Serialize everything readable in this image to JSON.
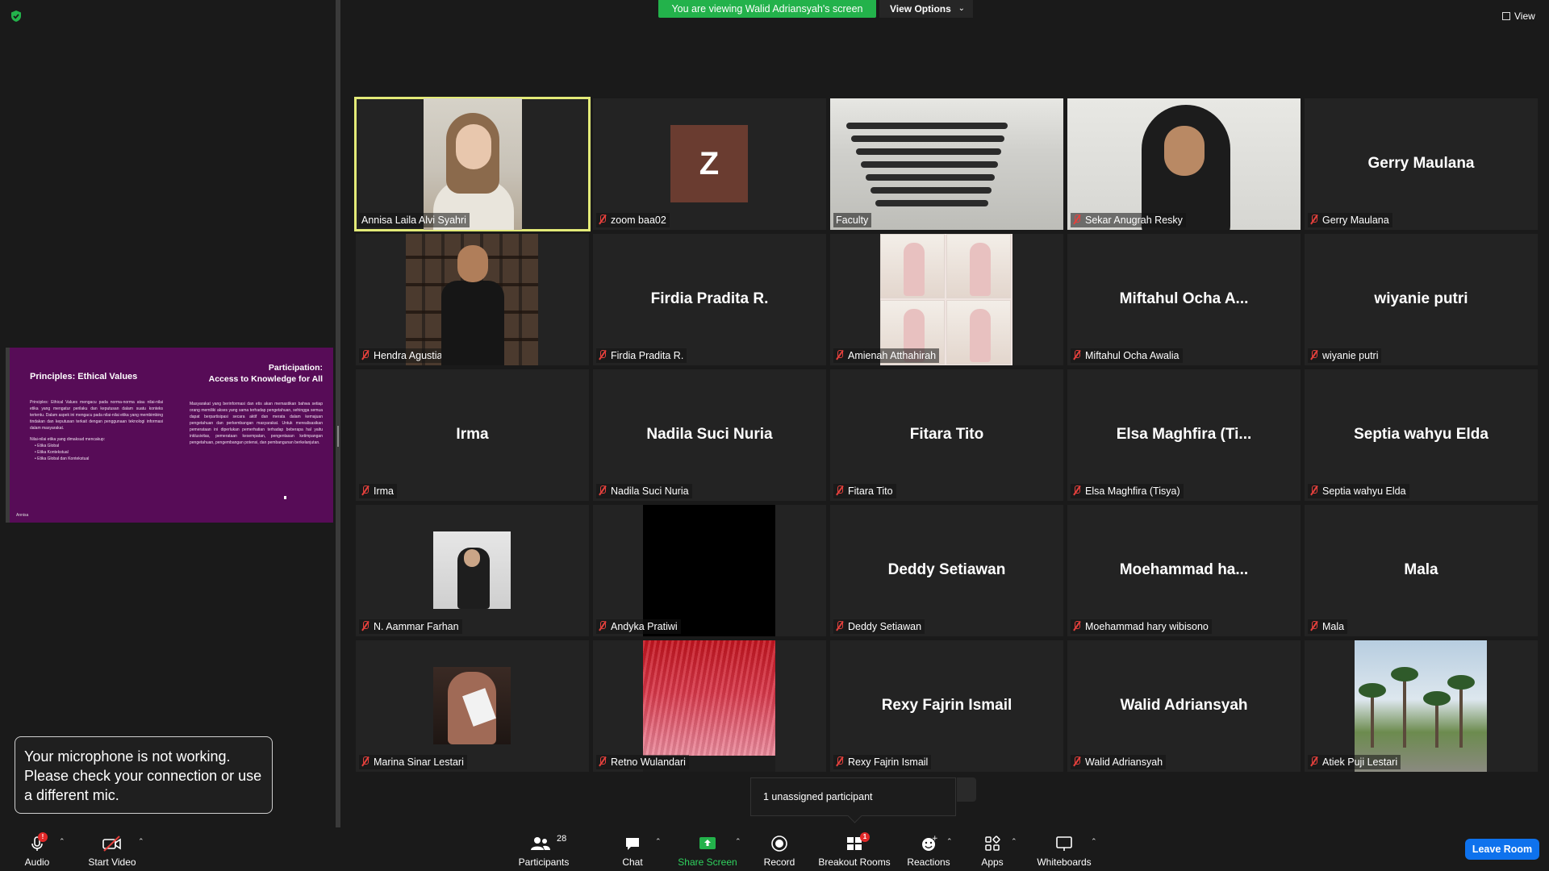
{
  "banner": {
    "viewing_text": "You are viewing Walid Adriansyah's screen",
    "view_options_label": "View Options",
    "view_label": "View"
  },
  "shared_screen": {
    "left_title": "Principles: Ethical Values",
    "left_body": "Principles: Ethical Values mengacu pada norma-norma atau nilai-nilai etika yang mengatur perilaku dan keputusan dalam suatu konteks tertentu. Dalam aspek ini mengacu pada nilai-nilai etika yang membimbing tindakan dan keputusan terkait dengan penggunaan teknologi informasi dalam masyarakat.",
    "left_sub": "Nilai-nilai etika yang dimaksud mencakup:",
    "left_list": [
      "Etika Global",
      "Etika Kontekstual",
      "Etika Global dan Kontekstual"
    ],
    "right_title_1": "Participation:",
    "right_title_2": "Access to Knowledge for All",
    "right_body": "Masyarakat yang berinformasi dan etis akan memastikan bahwa setiap orang memiliki akses yang sama terhadap pengetahuan, sehingga semua dapat berpartisipasi secara aktif dan merata dalam kemajuan pengetahuan dan perkembangan masyarakat. Untuk merealisasikan pemerataan ini diperlukan pemerhatian terhadap beberapa hal yaitu inklusivitas, pemerataan kesempatan, pengentasan ketimpangan pengetahuan, pengembangan potensi, dan pembangunan berkelanjutan.",
    "footer": "Annisa"
  },
  "mic_toast": {
    "message": "Your microphone is not working. Please check your connection or use a different mic."
  },
  "participants": [
    {
      "label": "Annisa Laila Alvi Syahri",
      "big": "",
      "video": "annisa",
      "muted": false,
      "active": true
    },
    {
      "label": "zoom baa02",
      "big": "",
      "video": "avatar-z",
      "avatar_letter": "Z",
      "muted": true
    },
    {
      "label": "Faculty",
      "big": "",
      "video": "class",
      "muted": false
    },
    {
      "label": "Sekar Anugrah Resky",
      "big": "",
      "video": "sekar",
      "muted": true
    },
    {
      "label": "Gerry Maulana",
      "big": "Gerry Maulana",
      "video": "none",
      "muted": true
    },
    {
      "label": "Hendra Agustian",
      "big": "",
      "video": "hendra",
      "muted": true
    },
    {
      "label": "Firdia Pradita R.",
      "big": "Firdia Pradita R.",
      "video": "none",
      "muted": true
    },
    {
      "label": "Amienah Atthahirah",
      "big": "",
      "video": "amienah",
      "muted": true
    },
    {
      "label": "Miftahul Ocha Awalia",
      "big": "Miftahul Ocha A...",
      "video": "none",
      "muted": true
    },
    {
      "label": "wiyanie putri",
      "big": "wiyanie putri",
      "video": "none",
      "muted": true
    },
    {
      "label": "Irma",
      "big": "Irma",
      "video": "none",
      "muted": true
    },
    {
      "label": "Nadila Suci Nuria",
      "big": "Nadila Suci Nuria",
      "video": "none",
      "muted": true
    },
    {
      "label": "Fitara Tito",
      "big": "Fitara Tito",
      "video": "none",
      "muted": true
    },
    {
      "label": "Elsa Maghfira (Tisya)",
      "big": "Elsa Maghfira (Ti...",
      "video": "none",
      "muted": true
    },
    {
      "label": "Septia wahyu Elda",
      "big": "Septia wahyu Elda",
      "video": "none",
      "muted": true
    },
    {
      "label": "N. Aammar Farhan",
      "big": "",
      "video": "farhan",
      "muted": true
    },
    {
      "label": "Andyka Pratiwi",
      "big": "",
      "video": "black",
      "muted": true
    },
    {
      "label": "Deddy Setiawan",
      "big": "Deddy Setiawan",
      "video": "none",
      "muted": true
    },
    {
      "label": "Moehammad hary wibisono",
      "big": "Moehammad  ha...",
      "video": "none",
      "muted": true
    },
    {
      "label": "Mala",
      "big": "Mala",
      "video": "none",
      "muted": true
    },
    {
      "label": "Marina Sinar Lestari",
      "big": "",
      "video": "marina",
      "muted": true
    },
    {
      "label": "Retno Wulandari",
      "big": "",
      "video": "hair",
      "muted": true
    },
    {
      "label": "Rexy Fajrin Ismail",
      "big": "Rexy Fajrin Ismail",
      "video": "none",
      "muted": true
    },
    {
      "label": "Walid Adriansyah",
      "big": "Walid Adriansyah",
      "video": "none",
      "muted": true
    },
    {
      "label": "Atiek Puji Lestari",
      "big": "",
      "video": "palm",
      "muted": true
    }
  ],
  "unassigned": {
    "text": "1 unassigned participant"
  },
  "toolbar": {
    "audio": "Audio",
    "audio_badge": "!",
    "start_video": "Start Video",
    "participants": "Participants",
    "participants_count": "28",
    "chat": "Chat",
    "share_screen": "Share Screen",
    "record": "Record",
    "breakout_rooms": "Breakout Rooms",
    "breakout_badge": "1",
    "reactions": "Reactions",
    "apps": "Apps",
    "whiteboards": "Whiteboards",
    "leave_room": "Leave Room"
  },
  "colors": {
    "banner_green": "#23b24b",
    "active_speaker": "#e3ea78",
    "leave_blue": "#0e72ed",
    "muted_red": "#e5403c",
    "share_purple": "#570c57"
  }
}
